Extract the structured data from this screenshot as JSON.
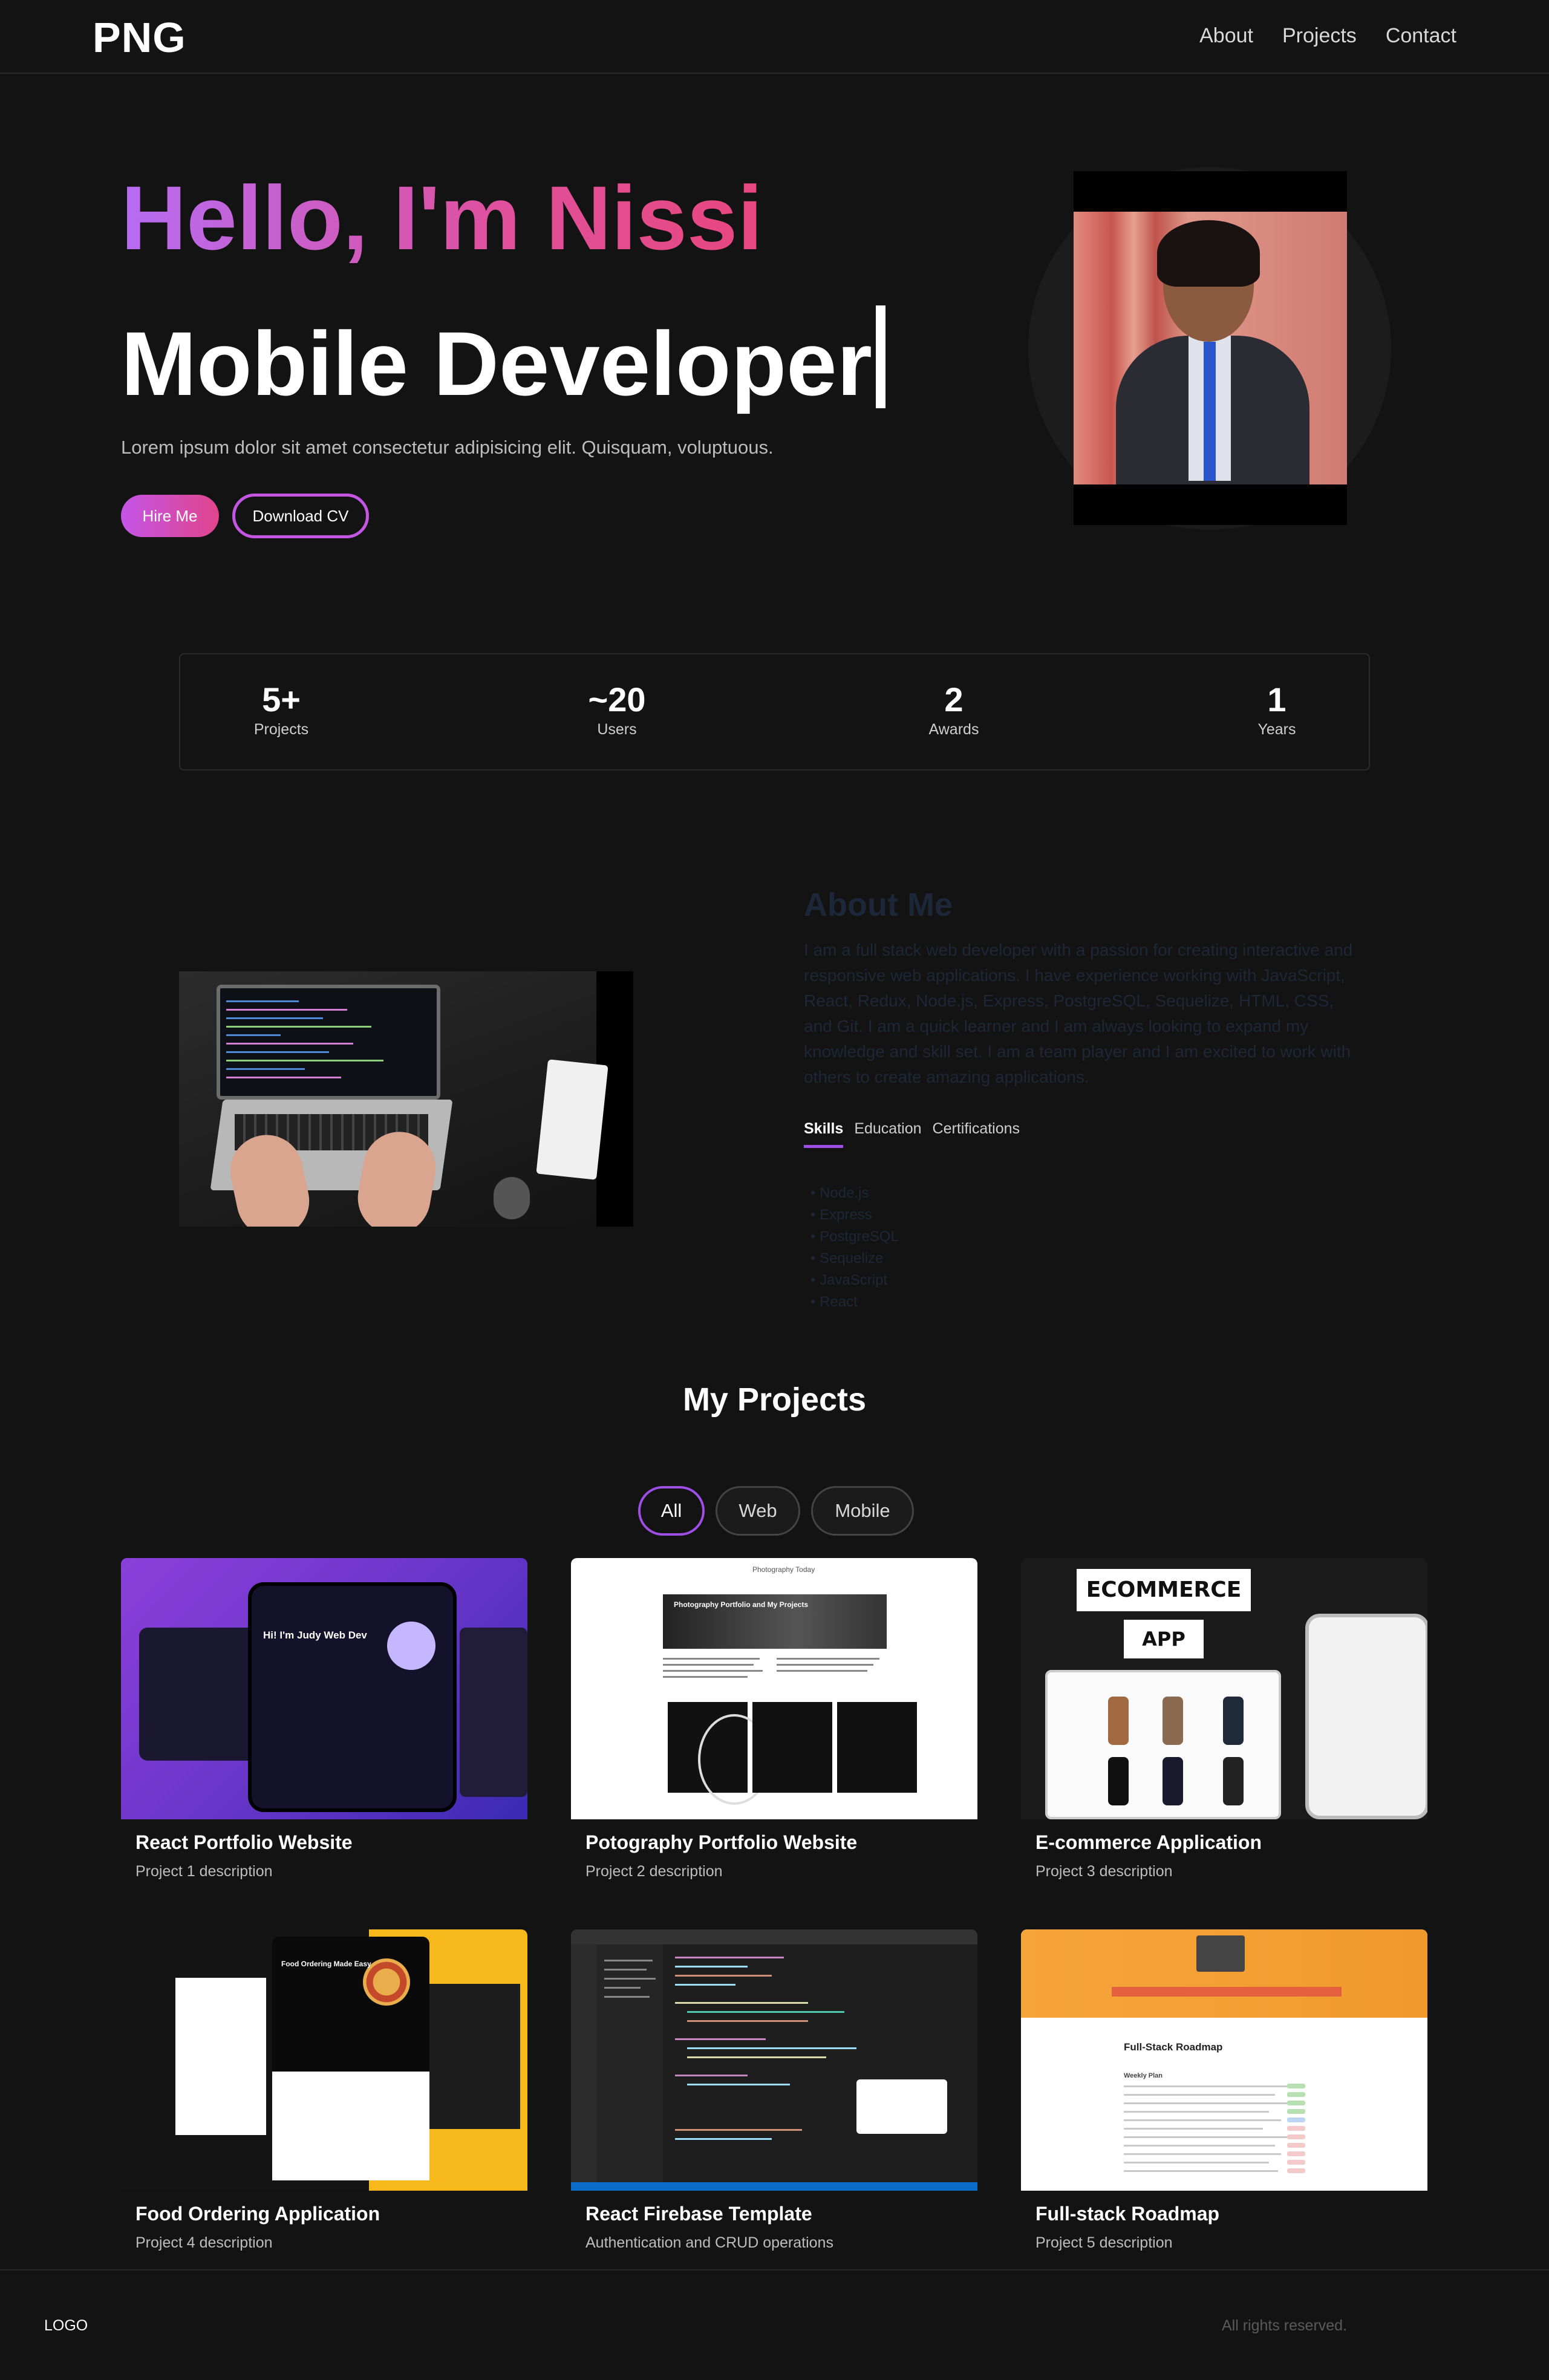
{
  "navbar": {
    "brand": "PNG",
    "links": [
      "About",
      "Projects",
      "Contact"
    ]
  },
  "hero": {
    "greeting": "Hello, I'm Nissi",
    "role": "Mobile Developer",
    "description": "Lorem ipsum dolor sit amet consectetur adipisicing elit. Quisquam, voluptuous.",
    "hire_label": "Hire Me",
    "cv_label": "Download CV"
  },
  "stats": [
    {
      "value": "5+",
      "label": "Projects"
    },
    {
      "value": "~20",
      "label": "Users"
    },
    {
      "value": "2",
      "label": "Awards"
    },
    {
      "value": "1",
      "label": "Years"
    }
  ],
  "about": {
    "title": "About Me",
    "text": "I am a full stack web developer with a passion for creating interactive and responsive web applications. I have experience working with JavaScript, React, Redux, Node.js, Express, PostgreSQL, Sequelize, HTML, CSS, and Git. I am a quick learner and I am always looking to expand my knowledge and skill set. I am a team player and I am excited to work with others to create amazing applications.",
    "tabs": [
      "Skills",
      "Education",
      "Certifications"
    ],
    "skills": [
      "Node.js",
      "Express",
      "PostgreSQL",
      "Sequelize",
      "JavaScript",
      "React"
    ]
  },
  "projects": {
    "title": "My Projects",
    "filters": [
      "All",
      "Web",
      "Mobile"
    ],
    "items": [
      {
        "title": "React Portfolio Website",
        "description": "Project 1 description"
      },
      {
        "title": "Potography Portfolio Website",
        "description": "Project 2 description"
      },
      {
        "title": "E-commerce Application",
        "description": "Project 3 description"
      },
      {
        "title": "Food Ordering Application",
        "description": "Project 4 description"
      },
      {
        "title": "React Firebase Template",
        "description": "Authentication and CRUD operations"
      },
      {
        "title": "Full-stack Roadmap",
        "description": "Project 5 description"
      }
    ],
    "thumb_text": {
      "t1_heading": "Hi! I'm Judy Web Dev",
      "t2_heading": "Photography Portfolio and My Projects",
      "t2_site": "Photography Today",
      "t3_sign1": "ECOMMERCE",
      "t3_sign2": "APP",
      "t4_heading": "Food Ordering Made Easy",
      "t6_heading": "Full-Stack Roadmap",
      "t6_sub": "Weekly Plan"
    }
  },
  "footer": {
    "logo": "LOGO",
    "rights": "All rights reserved."
  },
  "colors": {
    "background": "#131313",
    "accent_purple": "#9d4fe6",
    "accent_pink": "#e0458c"
  }
}
